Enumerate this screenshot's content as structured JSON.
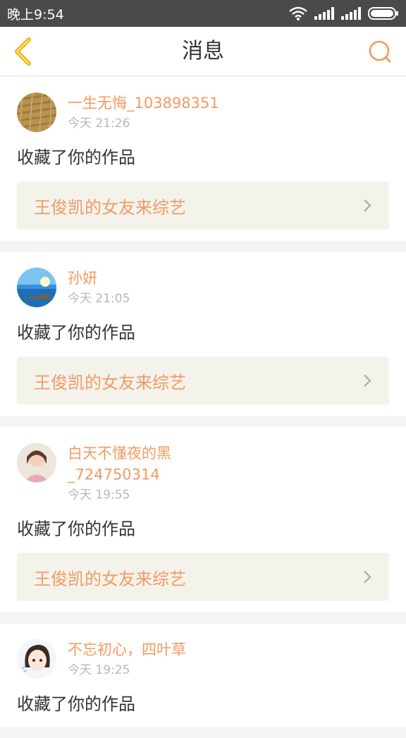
{
  "status_bar": {
    "time": "晚上9:54"
  },
  "header": {
    "title": "消息"
  },
  "colors": {
    "accent": "#f39a62",
    "back_icon": "#f0b400",
    "link_bg": "#f3f3ec"
  },
  "messages": [
    {
      "user": "一生无悔_103898351",
      "time": "今天 21:26",
      "action": "收藏了你的作品",
      "work": "王俊凯的女友来综艺"
    },
    {
      "user": "孙妍",
      "time": "今天 21:05",
      "action": "收藏了你的作品",
      "work": "王俊凯的女友来综艺"
    },
    {
      "user": "白天不懂夜的黑\n_724750314",
      "time": "今天 19:55",
      "action": "收藏了你的作品",
      "work": "王俊凯的女友来综艺"
    },
    {
      "user": "不忘初心，四叶草",
      "time": "今天 19:25",
      "action": "收藏了你的作品"
    }
  ]
}
